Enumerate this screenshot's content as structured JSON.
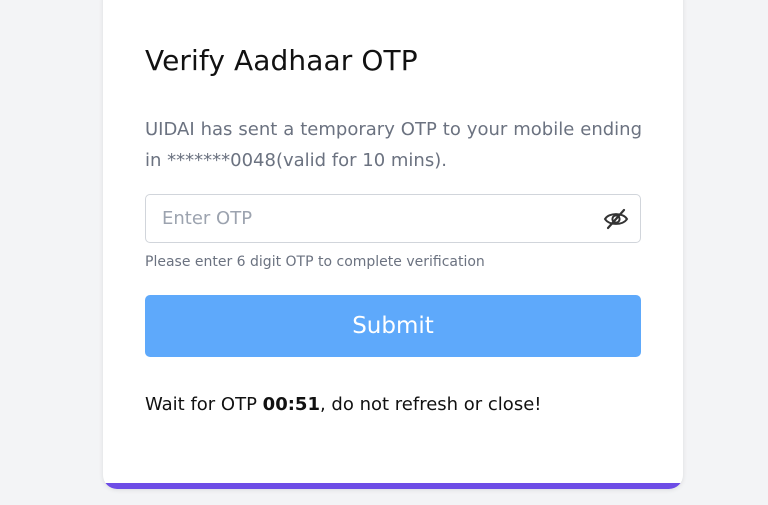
{
  "otp_card": {
    "title": "Verify Aadhaar OTP",
    "description": "UIDAI has sent a temporary OTP to your mobile ending in *******0048(valid for 10 mins).",
    "otp_input": {
      "value": "",
      "placeholder": "Enter OTP"
    },
    "visibility_toggle_icon": "eye-slash-icon",
    "hint": "Please enter 6 digit OTP to complete verification",
    "submit_label": "Submit",
    "wait_message": {
      "prefix": "Wait for OTP ",
      "timer": "00:51",
      "suffix": ", do not refresh or close!"
    }
  },
  "colors": {
    "page_background": "#f3f4f6",
    "card_background": "#ffffff",
    "submit_button": "#5ea9fb",
    "card_accent_bar": "#6d4ce6"
  }
}
